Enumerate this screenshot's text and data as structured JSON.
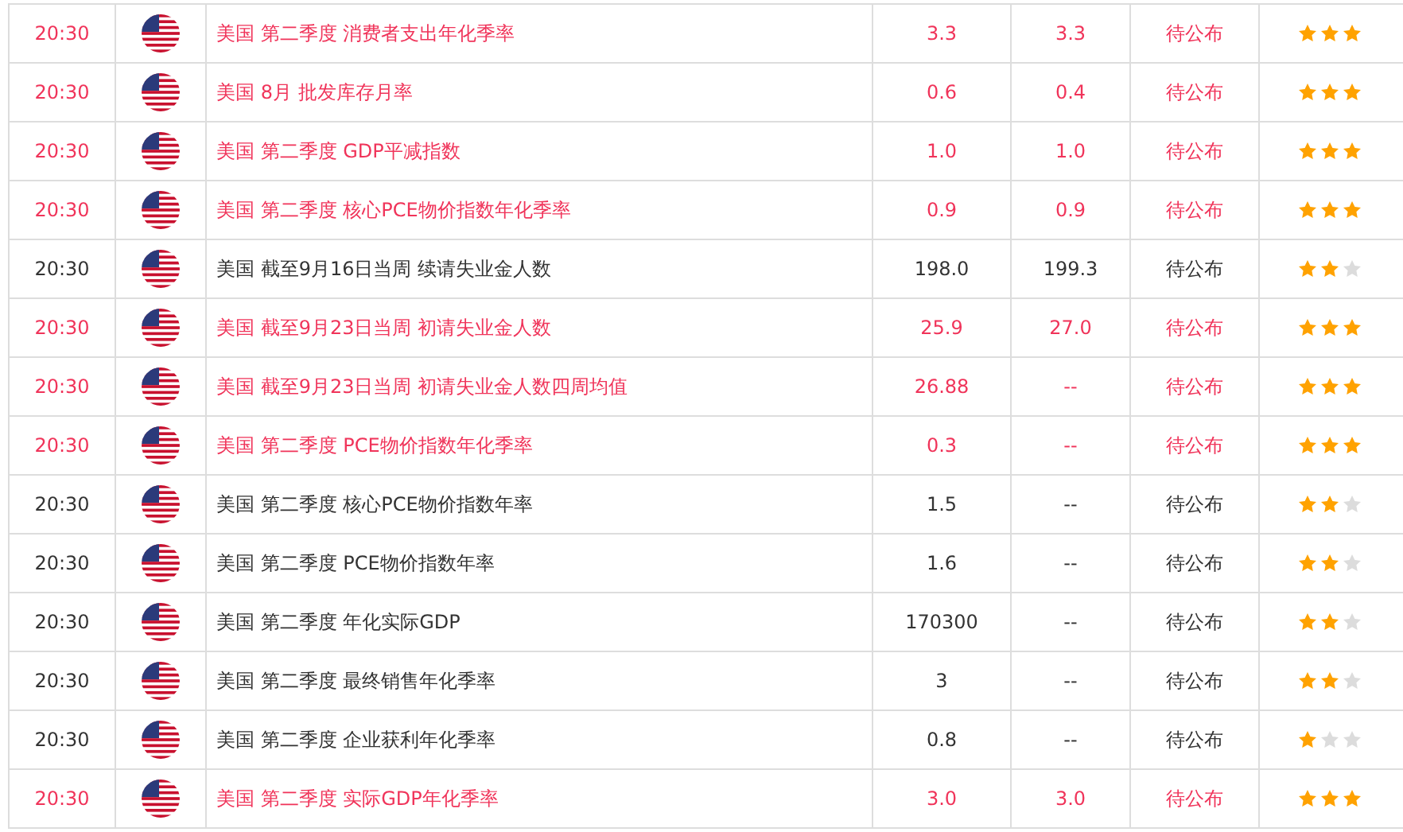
{
  "rows": [
    {
      "time": "20:30",
      "event": "美国 第二季度 消费者支出年化季率",
      "previous": "3.3",
      "forecast": "3.3",
      "status": "待公布",
      "important": true,
      "stars": 3
    },
    {
      "time": "20:30",
      "event": "美国 8月 批发库存月率",
      "previous": "0.6",
      "forecast": "0.4",
      "status": "待公布",
      "important": true,
      "stars": 3
    },
    {
      "time": "20:30",
      "event": "美国 第二季度 GDP平减指数",
      "previous": "1.0",
      "forecast": "1.0",
      "status": "待公布",
      "important": true,
      "stars": 3
    },
    {
      "time": "20:30",
      "event": "美国 第二季度 核心PCE物价指数年化季率",
      "previous": "0.9",
      "forecast": "0.9",
      "status": "待公布",
      "important": true,
      "stars": 3
    },
    {
      "time": "20:30",
      "event": "美国 截至9月16日当周 续请失业金人数",
      "previous": "198.0",
      "forecast": "199.3",
      "status": "待公布",
      "important": false,
      "stars": 2
    },
    {
      "time": "20:30",
      "event": "美国 截至9月23日当周 初请失业金人数",
      "previous": "25.9",
      "forecast": "27.0",
      "status": "待公布",
      "important": true,
      "stars": 3
    },
    {
      "time": "20:30",
      "event": "美国 截至9月23日当周 初请失业金人数四周均值",
      "previous": "26.88",
      "forecast": "--",
      "status": "待公布",
      "important": true,
      "stars": 3
    },
    {
      "time": "20:30",
      "event": "美国 第二季度 PCE物价指数年化季率",
      "previous": "0.3",
      "forecast": "--",
      "status": "待公布",
      "important": true,
      "stars": 3
    },
    {
      "time": "20:30",
      "event": "美国 第二季度 核心PCE物价指数年率",
      "previous": "1.5",
      "forecast": "--",
      "status": "待公布",
      "important": false,
      "stars": 2
    },
    {
      "time": "20:30",
      "event": "美国 第二季度 PCE物价指数年率",
      "previous": "1.6",
      "forecast": "--",
      "status": "待公布",
      "important": false,
      "stars": 2
    },
    {
      "time": "20:30",
      "event": "美国 第二季度 年化实际GDP",
      "previous": "170300",
      "forecast": "--",
      "status": "待公布",
      "important": false,
      "stars": 2
    },
    {
      "time": "20:30",
      "event": "美国 第二季度 最终销售年化季率",
      "previous": "3",
      "forecast": "--",
      "status": "待公布",
      "important": false,
      "stars": 2
    },
    {
      "time": "20:30",
      "event": "美国 第二季度 企业获利年化季率",
      "previous": "0.8",
      "forecast": "--",
      "status": "待公布",
      "important": false,
      "stars": 1
    },
    {
      "time": "20:30",
      "event": "美国 第二季度 实际GDP年化季率",
      "previous": "3.0",
      "forecast": "3.0",
      "status": "待公布",
      "important": true,
      "stars": 3
    }
  ]
}
